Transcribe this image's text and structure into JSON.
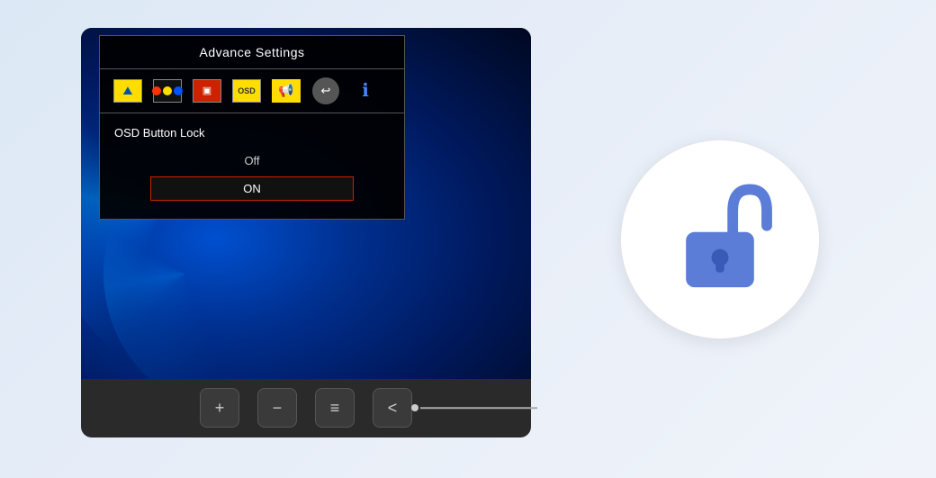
{
  "osd": {
    "title": "Advance Settings",
    "icons": [
      {
        "name": "image-icon",
        "label": "Image"
      },
      {
        "name": "color-icon",
        "label": "Color"
      },
      {
        "name": "advanced-icon",
        "label": "Advanced"
      },
      {
        "name": "osd-menu-icon",
        "label": "OSD"
      },
      {
        "name": "audio-icon",
        "label": "Audio"
      },
      {
        "name": "input-icon",
        "label": "Input"
      },
      {
        "name": "info-icon",
        "label": "Info"
      }
    ],
    "section_title": "OSD Button Lock",
    "options": [
      "Off",
      "ON"
    ],
    "selected_option": "ON"
  },
  "buttons": {
    "plus": "+",
    "minus": "−",
    "menu": "≡",
    "back": "<"
  },
  "lock": {
    "state": "unlocked",
    "aria_label": "Lock icon - unlocked"
  }
}
